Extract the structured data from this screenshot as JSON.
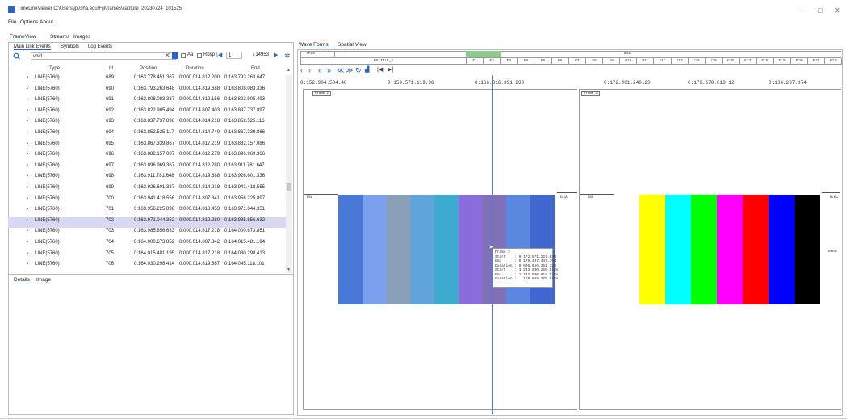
{
  "window": {
    "title": "TimeLineViewer C:\\Users\\jp\\\\sha.edu\\Fiji\\frames\\capture_20230724_101525",
    "min": "–",
    "max": "□",
    "close": "✕"
  },
  "menu": [
    "File",
    "Options",
    "About"
  ],
  "left_tabs": [
    "FrameView",
    "Streams",
    "Images"
  ],
  "sub_tabs": [
    "Main Link Events",
    "Symbols",
    "Log Events"
  ],
  "search": {
    "value": "vbid",
    "aa": "Aa",
    "rbsp": "Rbsp",
    "page": "1",
    "total": "/ 14953"
  },
  "table": {
    "columns": [
      "Type",
      "Id",
      "Position",
      "Duration",
      "End"
    ],
    "rows": [
      {
        "type": "LINE(5760)",
        "id": "689",
        "pos": "0:163.778.451.367",
        "dur": "0:000.014.812.200",
        "end": "0:163.793.263.647",
        "sel": false
      },
      {
        "type": "LINE(5760)",
        "id": "690",
        "pos": "0:163.793.263.648",
        "dur": "0:000.014.819.688",
        "end": "0:163.808.083.336",
        "sel": false
      },
      {
        "type": "LINE(5760)",
        "id": "691",
        "pos": "0:163.808.083.337",
        "dur": "0:000.014.812.156",
        "end": "0:163.822.905.493",
        "sel": false
      },
      {
        "type": "LINE(5760)",
        "id": "692",
        "pos": "0:163.822.905.494",
        "dur": "0:000.014.807.403",
        "end": "0:163.837.737.897",
        "sel": false
      },
      {
        "type": "LINE(5760)",
        "id": "693",
        "pos": "0:163.837.737.898",
        "dur": "0:000.014.814.218",
        "end": "0:163.852.525.116",
        "sel": false
      },
      {
        "type": "LINE(5760)",
        "id": "694",
        "pos": "0:163.852.525.117",
        "dur": "0:000.014.814.749",
        "end": "0:163.867.339.866",
        "sel": false
      },
      {
        "type": "LINE(5760)",
        "id": "695",
        "pos": "0:163.867.339.867",
        "dur": "0:000.014.817.219",
        "end": "0:163.882.157.086",
        "sel": false
      },
      {
        "type": "LINE(5760)",
        "id": "696",
        "pos": "0:163.882.157.087",
        "dur": "0:000.014.812.279",
        "end": "0:163.896.969.366",
        "sel": false
      },
      {
        "type": "LINE(5760)",
        "id": "697",
        "pos": "0:163.896.969.367",
        "dur": "0:000.014.812.280",
        "end": "0:163.911.781.647",
        "sel": false
      },
      {
        "type": "LINE(5760)",
        "id": "698",
        "pos": "0:163.911.781.648",
        "dur": "0:000.014.819.688",
        "end": "0:163.926.601.336",
        "sel": false
      },
      {
        "type": "LINE(5760)",
        "id": "699",
        "pos": "0:163.926.601.337",
        "dur": "0:000.014.814.218",
        "end": "0:163.941.418.555",
        "sel": false
      },
      {
        "type": "LINE(5760)",
        "id": "700",
        "pos": "0:163.941.418.556",
        "dur": "0:000.014.807.341",
        "end": "0:163.956.225.897",
        "sel": false
      },
      {
        "type": "LINE(5760)",
        "id": "701",
        "pos": "0:163.956.225.898",
        "dur": "0:000.014.818.453",
        "end": "0:163.971.044.351",
        "sel": false
      },
      {
        "type": "LINE(5760)",
        "id": "702",
        "pos": "0:163.971.044.352",
        "dur": "0:000.014.812.280",
        "end": "0:163.985.856.632",
        "sel": true
      },
      {
        "type": "LINE(5760)",
        "id": "703",
        "pos": "0:163.985.856.633",
        "dur": "0:000.014.817.218",
        "end": "0:164.000.673.851",
        "sel": false
      },
      {
        "type": "LINE(5760)",
        "id": "704",
        "pos": "0:164.000.673.852",
        "dur": "0:000.014.807.342",
        "end": "0:164.015.481.194",
        "sel": false
      },
      {
        "type": "LINE(5760)",
        "id": "705",
        "pos": "0:164.015.481.195",
        "dur": "0:000.014.817.218",
        "end": "0:164.030.298.413",
        "sel": false
      },
      {
        "type": "LINE(5760)",
        "id": "706",
        "pos": "0:164.030.298.414",
        "dur": "0:000.014.819.687",
        "end": "0:164.045.118.101",
        "sel": false
      }
    ]
  },
  "details_tabs": [
    "Details",
    "Image"
  ],
  "right_tabs": [
    "Wave Forms",
    "Spatial View"
  ],
  "timeline": {
    "row1_left": "TPS4",
    "row1_right": "BS1",
    "row2_label": "BS-IDLE_1",
    "cells": [
      "F1",
      "F2",
      "F3",
      "F4",
      "F5",
      "F6",
      "F7",
      "F8",
      "F9",
      "F10",
      "F11",
      "F12",
      "F13",
      "F14",
      "F15",
      "F16",
      "F17",
      "F18",
      "F19",
      "F20",
      "F21",
      "F22"
    ]
  },
  "ruler": [
    "0:152.904.504.48",
    "0:159.571.119.36",
    "0:166.316.391.230",
    "0:172.901.240.20",
    "0:179.570.810.12",
    "0:186.237.374"
  ],
  "panes": {
    "left_frame": "Frame 2",
    "right_frame": "Frame 3",
    "left_start": "BSA",
    "left_end": "BLKA",
    "right_start": "BSA",
    "right_end": "BLKA",
    "right_side": "Data"
  },
  "tooltip": {
    "lines": [
      "Frame 2",
      "Start    : 0:172.571.221.039",
      "End      : 0:179.237.447.364",
      "Duration : 0:006.666.351.325",
      "Start    : 1 243 930 255 bits",
      "End      : 1 373 930 619 bits",
      "Duration :   129 999 375 bits"
    ]
  },
  "colors": {
    "accent": "#2a63c9",
    "selected_row": "#d8d8f5",
    "frame2_bars": [
      "#4878d8",
      "#7ca0ee",
      "#8aa0b8",
      "#60a4dc",
      "#3eaad0",
      "#8a6cdc",
      "#8070b8",
      "#5a88e0",
      "#4066d0"
    ],
    "frame3_bars": [
      "#ffffff",
      "#ffff00",
      "#00ffff",
      "#00ff00",
      "#ff00ff",
      "#ff0000",
      "#0000ff",
      "#000000"
    ]
  }
}
